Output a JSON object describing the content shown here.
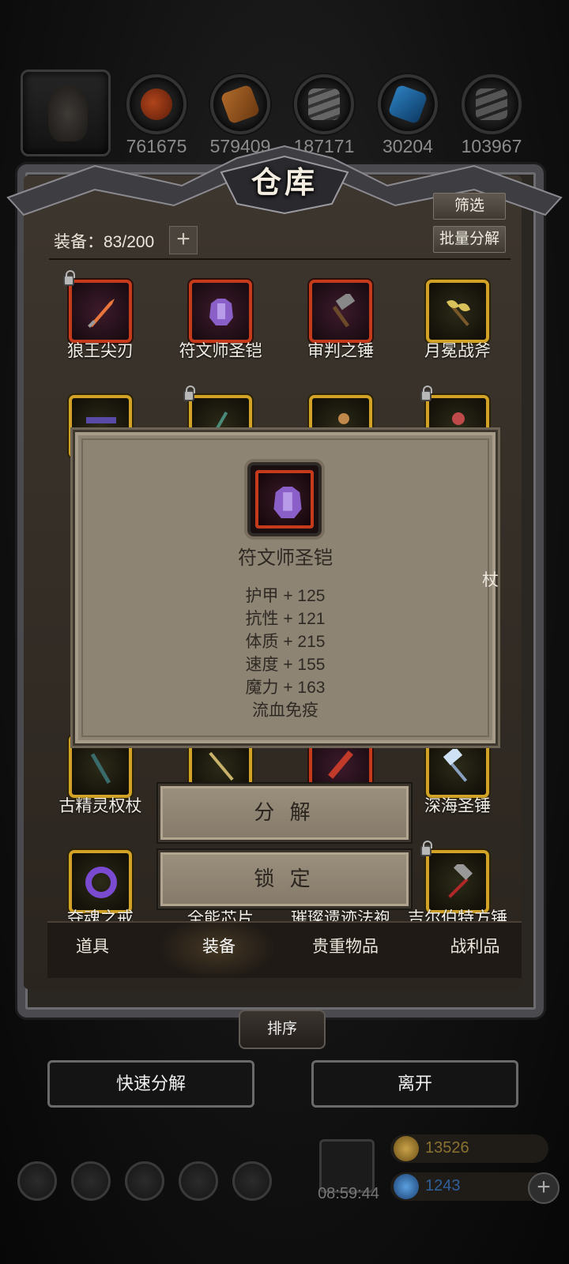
{
  "header": {
    "title": "仓库",
    "resources": [
      {
        "icon": "meat-icon",
        "value": "761675"
      },
      {
        "icon": "wood-icon",
        "value": "579409"
      },
      {
        "icon": "stone-icon",
        "value": "187171"
      },
      {
        "icon": "crystal-icon",
        "value": "30204"
      },
      {
        "icon": "iron-icon",
        "value": "103967"
      }
    ]
  },
  "toolbar": {
    "filter_label": "筛选",
    "batch_decompose_label": "批量分解",
    "equip_count": "装备：83/200",
    "expand_label": "+"
  },
  "items": [
    {
      "name": "狼王尖刃",
      "rarity": "red",
      "locked": true,
      "icon": "dagger-icon"
    },
    {
      "name": "符文师圣铠",
      "rarity": "red",
      "locked": false,
      "icon": "armor-icon"
    },
    {
      "name": "审判之锤",
      "rarity": "red",
      "locked": false,
      "icon": "hammer-icon"
    },
    {
      "name": "月冕战斧",
      "rarity": "gold",
      "locked": false,
      "icon": "axe-icon"
    },
    {
      "name": "古精灵权杖",
      "rarity": "gold",
      "locked": false,
      "icon": "scepter-icon"
    },
    {
      "name": "深海圣锤",
      "rarity": "gold",
      "locked": false,
      "icon": "mace-icon"
    },
    {
      "name": "夺魂之戒",
      "rarity": "gold",
      "locked": false,
      "icon": "ring-icon"
    },
    {
      "name": "全能芯片",
      "rarity": "gold",
      "locked": false,
      "icon": "chip-icon"
    },
    {
      "name": "璀璨遗迹法袍",
      "rarity": "red",
      "locked": false,
      "icon": "robe-icon"
    },
    {
      "name": "吉尔伯特方锤",
      "rarity": "gold",
      "locked": true,
      "icon": "warhammer-icon"
    },
    {
      "name": "",
      "rarity": "gold",
      "locked": false,
      "icon": "gun-icon"
    },
    {
      "name": "",
      "rarity": "gold",
      "locked": true,
      "icon": "sword-icon"
    },
    {
      "name": "",
      "rarity": "gold",
      "locked": false,
      "icon": "amulet-icon"
    },
    {
      "name": "",
      "rarity": "gold",
      "locked": true,
      "icon": "gem-icon"
    },
    {
      "name": "",
      "rarity": "gold",
      "locked": false,
      "icon": "staff-icon"
    },
    {
      "name": "",
      "rarity": "gold",
      "locked": false,
      "icon": "spear-icon"
    },
    {
      "name": "",
      "rarity": "red",
      "locked": false,
      "icon": "blade-icon"
    }
  ],
  "partial_label_right": "杖",
  "tabs": [
    {
      "label": "道具"
    },
    {
      "label": "装备",
      "active": true
    },
    {
      "label": "贵重物品"
    },
    {
      "label": "战利品"
    }
  ],
  "sort_label": "排序",
  "bottom": {
    "quick_decompose_label": "快速分解",
    "leave_label": "离开"
  },
  "popup": {
    "item_name": "符文师圣铠",
    "stats": [
      "护甲 + 125",
      "抗性 + 121",
      "体质 + 215",
      "速度 + 155",
      "魔力 + 163",
      "流血免疫"
    ],
    "decompose_label": "分 解",
    "lock_label": "锁 定"
  },
  "hud": {
    "timer": "08:59:44",
    "gold": "13526",
    "gems": "1243",
    "gold_color": "#8a7230",
    "gem_color": "#2f5f9a"
  }
}
